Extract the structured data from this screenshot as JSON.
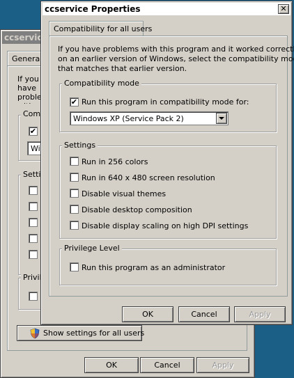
{
  "back_window": {
    "title": "ccservice Properties",
    "tab_label": "General",
    "intro_fragment": "If you have problems with this program and it worked correctly on an earlier version of Windows, select the compatibility mode that matches that earlier version.",
    "compat_group_label": "Compatibility mode",
    "compat_combo_value": "Windows XP (Service Pack 2)",
    "settings_group_label": "Settings",
    "privilege_group_label": "Privilege Level",
    "show_all_users_label": "Show settings for all users",
    "ok_label": "OK",
    "cancel_label": "Cancel",
    "apply_label": "Apply"
  },
  "dialog": {
    "title": "ccservice Properties",
    "close_glyph": "✕",
    "tab_label": "Compatibility for all users",
    "intro_line1": "If you have problems with this program and it worked correctly",
    "intro_line2": "on an earlier version of Windows, select the compatibility mode",
    "intro_line3": "that matches that earlier version.",
    "compat_group_label": "Compatibility mode",
    "compat_checkbox_label": "Run this program in compatibility mode for:",
    "compat_checked": true,
    "compat_select_value": "Windows XP (Service Pack 2)",
    "settings_group_label": "Settings",
    "settings": [
      {
        "label": "Run in 256 colors",
        "checked": false
      },
      {
        "label": "Run in 640 x 480 screen resolution",
        "checked": false
      },
      {
        "label": "Disable visual themes",
        "checked": false
      },
      {
        "label": "Disable desktop composition",
        "checked": false
      },
      {
        "label": "Disable display scaling on high DPI settings",
        "checked": false
      }
    ],
    "privilege_group_label": "Privilege Level",
    "privilege_checkbox_label": "Run this program as an administrator",
    "privilege_checked": false,
    "ok_label": "OK",
    "cancel_label": "Cancel",
    "apply_label": "Apply"
  }
}
